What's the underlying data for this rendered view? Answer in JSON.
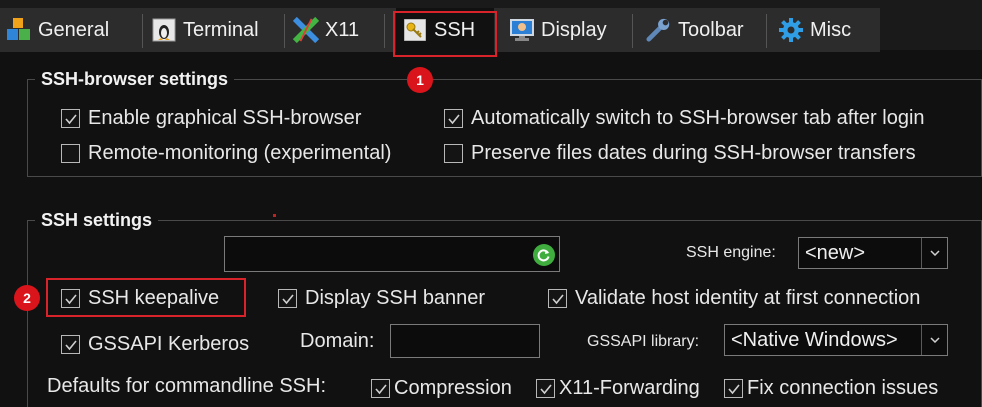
{
  "tabs": [
    {
      "label": "General",
      "icon": "cubes-icon"
    },
    {
      "label": "Terminal",
      "icon": "terminal-penguin-icon"
    },
    {
      "label": "X11",
      "icon": "x11-icon"
    },
    {
      "label": "SSH",
      "icon": "key-icon",
      "active": true
    },
    {
      "label": "Display",
      "icon": "monitor-icon"
    },
    {
      "label": "Toolbar",
      "icon": "wrench-icon"
    },
    {
      "label": "Misc",
      "icon": "gear-icon"
    }
  ],
  "browser_group": {
    "title": "SSH-browser settings",
    "options": {
      "enable_browser": {
        "label": "Enable graphical SSH-browser",
        "checked": true
      },
      "auto_switch": {
        "label": "Automatically switch to SSH-browser tab after login",
        "checked": true
      },
      "remote_monitoring": {
        "label": "Remote-monitoring (experimental)",
        "checked": false
      },
      "preserve_dates": {
        "label": "Preserve files dates during SSH-browser transfers",
        "checked": false
      }
    }
  },
  "ssh_group": {
    "title": "SSH settings",
    "engine_label": "SSH engine:",
    "engine_value": "<new>",
    "keepalive": {
      "label": "SSH keepalive",
      "checked": true
    },
    "display_banner": {
      "label": "Display SSH banner",
      "checked": true
    },
    "validate_host": {
      "label": "Validate host identity at first connection",
      "checked": true
    },
    "gssapi_kerberos": {
      "label": "GSSAPI Kerberos",
      "checked": true
    },
    "domain_label": "Domain:",
    "gssapi_library_label": "GSSAPI library:",
    "gssapi_library_value": "<Native Windows>",
    "defaults_label": "Defaults for commandline SSH:",
    "compression": {
      "label": "Compression",
      "checked": true
    },
    "x11_forwarding": {
      "label": "X11-Forwarding",
      "checked": true
    },
    "fix_connection": {
      "label": "Fix connection issues",
      "checked": true
    }
  },
  "annotations": {
    "badge1": "1",
    "badge2": "2"
  },
  "colors": {
    "highlight": "#d8232a",
    "badge": "#d9141b",
    "background": "#111111"
  }
}
